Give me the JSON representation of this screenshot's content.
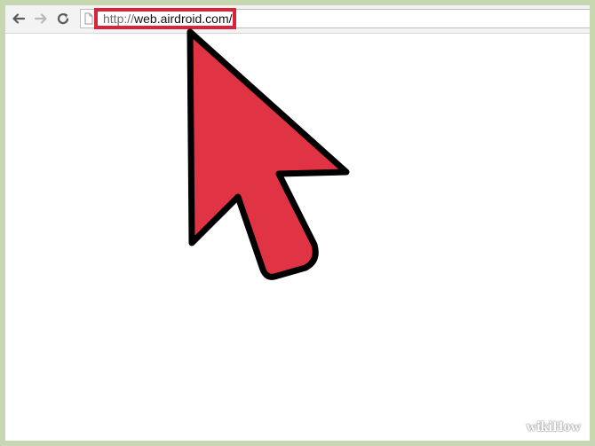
{
  "browser": {
    "address_bar": {
      "url_scheme": "http://",
      "url_host": "web.airdroid.com/"
    },
    "nav_buttons": [
      "back-icon",
      "forward-icon",
      "reload-icon"
    ]
  },
  "annotation": {
    "highlight_color": "#d7243a",
    "cursor_icon": "arrow-cursor-icon",
    "cursor_color": "#e03444"
  },
  "watermark": {
    "part1": "wiki",
    "part2": "How"
  },
  "colors": {
    "frame_border": "#c6d7b2",
    "toolbar": "#f3f3f3"
  }
}
